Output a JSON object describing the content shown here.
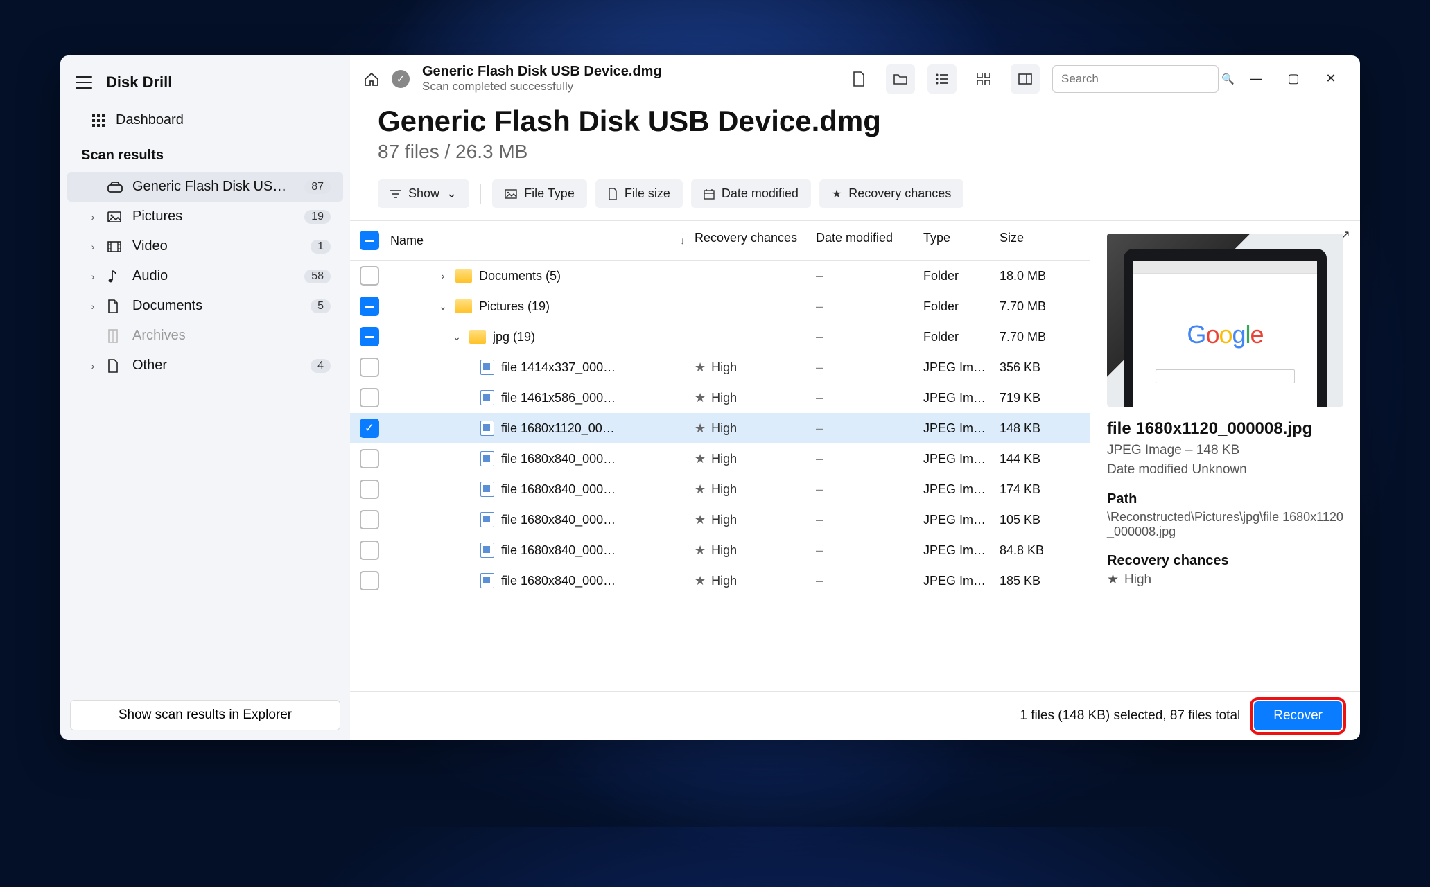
{
  "app_name": "Disk Drill",
  "sidebar": {
    "dashboard_label": "Dashboard",
    "section_title": "Scan results",
    "items": [
      {
        "label": "Generic Flash Disk USB D…",
        "count": "87",
        "active": true
      },
      {
        "label": "Pictures",
        "count": "19"
      },
      {
        "label": "Video",
        "count": "1"
      },
      {
        "label": "Audio",
        "count": "58"
      },
      {
        "label": "Documents",
        "count": "5"
      },
      {
        "label": "Archives"
      },
      {
        "label": "Other",
        "count": "4"
      }
    ],
    "explorer_btn": "Show scan results in Explorer"
  },
  "header": {
    "title": "Generic Flash Disk USB Device.dmg",
    "subtitle": "Scan completed successfully",
    "search_placeholder": "Search"
  },
  "page": {
    "h1": "Generic Flash Disk USB Device.dmg",
    "summary": "87 files / 26.3 MB"
  },
  "filters": {
    "show": "Show",
    "file_type": "File Type",
    "file_size": "File size",
    "date_modified": "Date modified",
    "recovery": "Recovery chances"
  },
  "columns": {
    "name": "Name",
    "recovery": "Recovery chances",
    "date": "Date modified",
    "type": "Type",
    "size": "Size"
  },
  "rows": [
    {
      "kind": "folder",
      "depth": 1,
      "expand": "›",
      "name": "Documents (5)",
      "rec": "",
      "date": "–",
      "type": "Folder",
      "size": "18.0 MB",
      "chk": "none"
    },
    {
      "kind": "folder",
      "depth": 1,
      "expand": "⌄",
      "name": "Pictures (19)",
      "rec": "",
      "date": "–",
      "type": "Folder",
      "size": "7.70 MB",
      "chk": "minus"
    },
    {
      "kind": "folder",
      "depth": 2,
      "expand": "⌄",
      "name": "jpg (19)",
      "rec": "",
      "date": "–",
      "type": "Folder",
      "size": "7.70 MB",
      "chk": "minus"
    },
    {
      "kind": "file",
      "depth": 3,
      "name": "file 1414x337_000…",
      "rec": "High",
      "date": "–",
      "type": "JPEG Im…",
      "size": "356 KB",
      "chk": "none"
    },
    {
      "kind": "file",
      "depth": 3,
      "name": "file 1461x586_000…",
      "rec": "High",
      "date": "–",
      "type": "JPEG Im…",
      "size": "719 KB",
      "chk": "none"
    },
    {
      "kind": "file",
      "depth": 3,
      "name": "file 1680x1120_00…",
      "rec": "High",
      "date": "–",
      "type": "JPEG Im…",
      "size": "148 KB",
      "chk": "check",
      "sel": true
    },
    {
      "kind": "file",
      "depth": 3,
      "name": "file 1680x840_000…",
      "rec": "High",
      "date": "–",
      "type": "JPEG Im…",
      "size": "144 KB",
      "chk": "none"
    },
    {
      "kind": "file",
      "depth": 3,
      "name": "file 1680x840_000…",
      "rec": "High",
      "date": "–",
      "type": "JPEG Im…",
      "size": "174 KB",
      "chk": "none"
    },
    {
      "kind": "file",
      "depth": 3,
      "name": "file 1680x840_000…",
      "rec": "High",
      "date": "–",
      "type": "JPEG Im…",
      "size": "105 KB",
      "chk": "none"
    },
    {
      "kind": "file",
      "depth": 3,
      "name": "file 1680x840_000…",
      "rec": "High",
      "date": "–",
      "type": "JPEG Im…",
      "size": "84.8 KB",
      "chk": "none"
    },
    {
      "kind": "file",
      "depth": 3,
      "name": "file 1680x840_000…",
      "rec": "High",
      "date": "–",
      "type": "JPEG Im…",
      "size": "185 KB",
      "chk": "none"
    }
  ],
  "preview": {
    "title": "file 1680x1120_000008.jpg",
    "meta": "JPEG Image – 148 KB",
    "date": "Date modified Unknown",
    "path_label": "Path",
    "path": "\\Reconstructed\\Pictures\\jpg\\file 1680x1120_000008.jpg",
    "recovery_label": "Recovery chances",
    "recovery_value": "High"
  },
  "footer": {
    "status": "1 files (148 KB) selected, 87 files total",
    "recover_label": "Recover"
  }
}
